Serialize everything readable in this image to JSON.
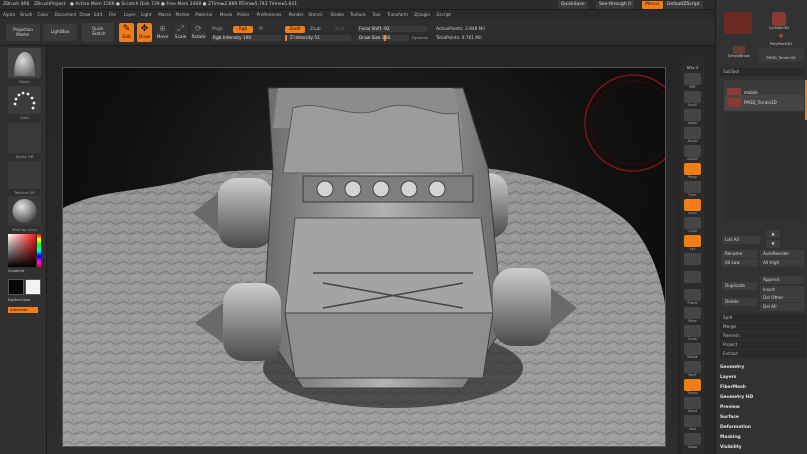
{
  "titlebar": {
    "app": "ZBrush 4R6",
    "project": "ZBrushProject",
    "stats": "● Active Mem 1566 ● Scratch Disk 739 ● Free Mem 2468 ● ZTime▸2.889 RTime▸5.743 Timer▸5.641",
    "quicksave": "QuickSave",
    "seethrough": "See-through  0",
    "menus": "Menus",
    "defaultzscript": "DefaultZScript"
  },
  "menubar": [
    "Alpha",
    "Brush",
    "Color",
    "Document",
    "Draw",
    "Edit",
    "File",
    "Layer",
    "Light",
    "Macro",
    "Marker",
    "Material",
    "Movie",
    "Picker",
    "Preferences",
    "Render",
    "Stencil",
    "Stroke",
    "Texture",
    "Tool",
    "Transform",
    "Zplugin",
    "Zscript"
  ],
  "shelf": {
    "projection_master": "Projection Master",
    "lightbox": "LightBox",
    "quick_sketch": "Quick Sketch",
    "edit": "Edit",
    "draw": "Draw",
    "move": "Move",
    "scale": "Scale",
    "rotate": "Rotate",
    "mrgb": "Mrgb",
    "rgb": "Rgb",
    "m": "M",
    "rgb_intensity": "Rgb Intensity 100",
    "zadd": "Zadd",
    "zsub": "Zsub",
    "zcut": "Zcut",
    "z_intensity": "Z Intensity 51",
    "focal_shift": "Focal Shift -92",
    "draw_size": "Draw Size 158",
    "dynamic": "Dynamic",
    "active_points": "ActivePoints: 3.948 Mil",
    "total_points": "TotalPoints: 9.761 Mil"
  },
  "lefttray": {
    "brush_caption": "Move",
    "stroke_caption": "Dots",
    "alpha_caption": "Alpha Off",
    "texture_caption": "Texture Off",
    "material_caption": "MatCap Gray",
    "gradient": "Gradient",
    "switchcolor": "SwitchColor",
    "alternate": "Alternate"
  },
  "rightshelf": {
    "spix": "SPix 3",
    "items": [
      "BPR",
      "Scroll",
      "Zoom",
      "Actual",
      "AAHalf",
      "Persp",
      "Floor",
      "Local",
      "L.Sym",
      "Xyz",
      "",
      "",
      "Frame",
      "Move",
      "Scale",
      "Rotate",
      "PolyF",
      "Transp",
      "Ghost",
      "Solo",
      "Xpose"
    ]
  },
  "righttray": {
    "thumbs": [
      "Cylinder3D",
      "PolyMesh3D",
      "SimpleBrush",
      "PM3D_Terrain3D"
    ],
    "subtool": "SubTool",
    "active_sub": "mobile",
    "second_sub": "PM3D_Terrain3D",
    "list_all": "List All",
    "rename": "Rename",
    "autoreorder": "AutoReorder",
    "all_low": "All Low",
    "all_high": "All High",
    "duplicate": "Duplicate",
    "append": "Append",
    "insert": "Insert",
    "delete": "Delete",
    "del_other": "Del Other",
    "del_all": "Del All",
    "split": "Split",
    "merge": "Merge",
    "remesh": "Remesh",
    "project": "Project",
    "extract": "Extract",
    "sections": [
      "Geometry",
      "Layers",
      "FiberMesh",
      "Geometry HD",
      "Preview",
      "Surface",
      "Deformation",
      "Masking",
      "Visibility"
    ]
  },
  "colors": {
    "accent": "#f07d17",
    "bg": "#262626"
  }
}
